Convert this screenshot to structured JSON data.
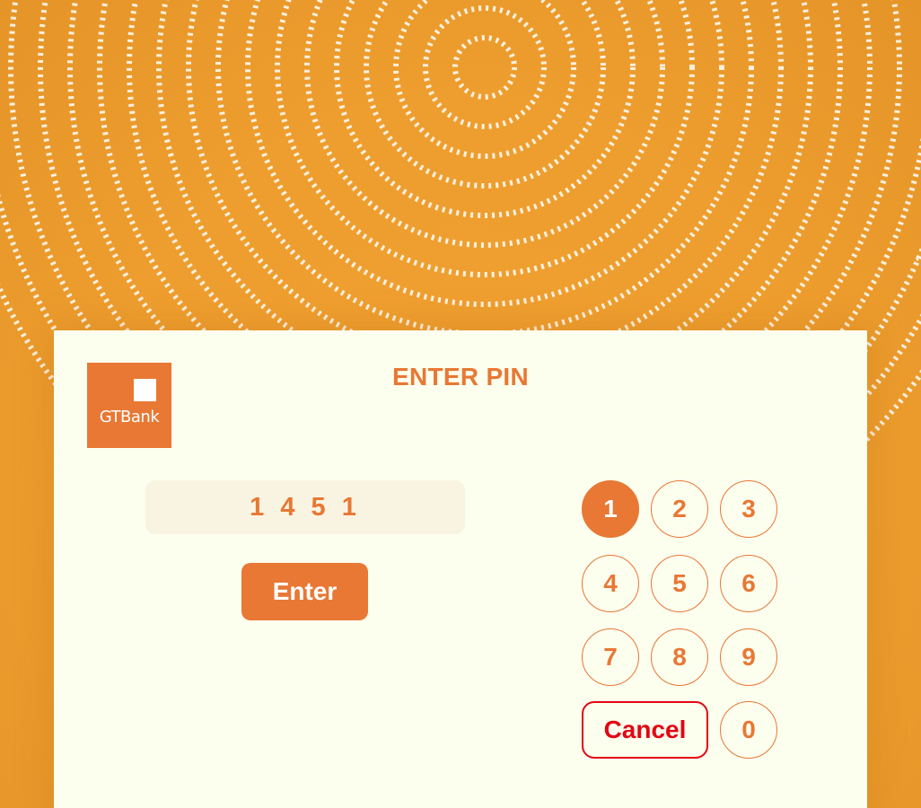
{
  "brand": {
    "name": "GTBank",
    "color": "#E87834",
    "logo_icon": "gtbank-logo-icon"
  },
  "screen": {
    "title": "ENTER PIN"
  },
  "pin": {
    "value": "1 4 5 1"
  },
  "actions": {
    "enter_label": "Enter",
    "cancel_label": "Cancel",
    "cancel_color": "#E30613"
  },
  "keypad": {
    "keys": [
      "1",
      "2",
      "3",
      "4",
      "5",
      "6",
      "7",
      "8",
      "9",
      "0"
    ],
    "active_key": "1"
  },
  "colors": {
    "background": "#EE9E2E",
    "card": "#FCFEEE",
    "pin_field": "#F9F4E2"
  }
}
